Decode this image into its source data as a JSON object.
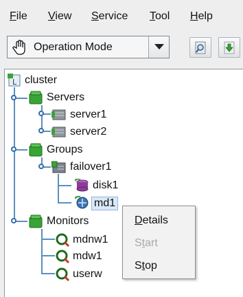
{
  "menubar": {
    "items": [
      {
        "label": "File",
        "mnemonic": "F",
        "rest": "ile"
      },
      {
        "label": "View",
        "mnemonic": "V",
        "rest": "iew"
      },
      {
        "label": "Service",
        "mnemonic": "S",
        "rest": "ervice"
      },
      {
        "label": "Tool",
        "mnemonic": "T",
        "rest": "ool"
      },
      {
        "label": "Help",
        "mnemonic": "H",
        "rest": "elp"
      }
    ]
  },
  "toolbar": {
    "mode_selected": "Operation Mode",
    "mode_icon": "hand-icon",
    "buttons": [
      {
        "icon": "search-icon"
      },
      {
        "icon": "download-icon"
      }
    ]
  },
  "tree": {
    "root": {
      "label": "cluster",
      "icon": "cluster-icon"
    },
    "servers": {
      "label": "Servers",
      "icon": "server-group-icon",
      "children": [
        "server1",
        "server2"
      ]
    },
    "groups": {
      "label": "Groups",
      "icon": "group-folder-icon"
    },
    "failover": {
      "label": "failover1",
      "icon": "failover-icon"
    },
    "resources": [
      "disk1",
      "md1"
    ],
    "monitors": {
      "label": "Monitors",
      "icon": "monitor-group-icon",
      "children": [
        "mdnw1",
        "mdw1",
        "userw"
      ]
    }
  },
  "context_menu": {
    "items": [
      {
        "label": "Details",
        "mnemonic": "D",
        "rest": "etails",
        "enabled": true
      },
      {
        "label": "Start",
        "mnemonic": "t",
        "pre": "S",
        "rest": "art",
        "enabled": false
      },
      {
        "label": "Stop",
        "mnemonic": "t",
        "pre": "S",
        "rest": "op",
        "enabled": true
      }
    ]
  },
  "colors": {
    "tree_line": "#5b8fbf",
    "group_green": "#3aa336",
    "selection_bg": "#dbe8f7",
    "disabled_text": "#a8a8a8"
  }
}
